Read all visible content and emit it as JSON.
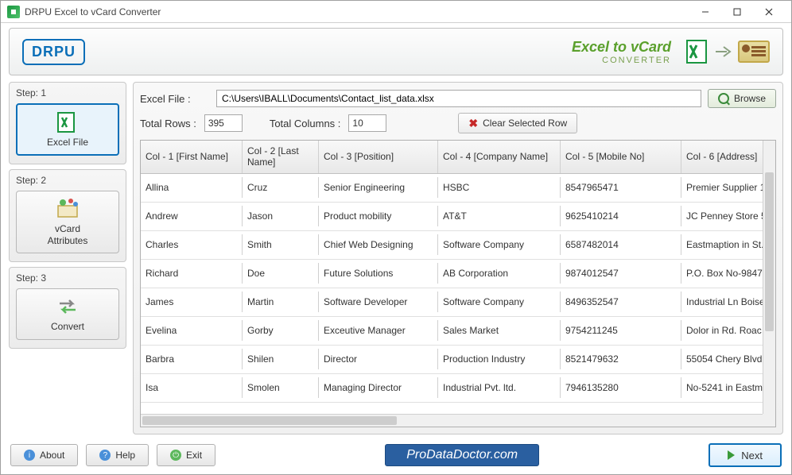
{
  "window": {
    "title": "DRPU Excel to vCard Converter"
  },
  "banner": {
    "logo": "DRPU",
    "title_main": "Excel to vCard",
    "title_sub": "CONVERTER"
  },
  "sidebar": {
    "steps": [
      {
        "label": "Step:  1",
        "btn": "Excel File"
      },
      {
        "label": "Step:  2",
        "btn": "vCard\nAttributes"
      },
      {
        "label": "Step:  3",
        "btn": "Convert"
      }
    ]
  },
  "main": {
    "file_label": "Excel File :",
    "file_path": "C:\\Users\\IBALL\\Documents\\Contact_list_data.xlsx",
    "browse": "Browse",
    "rows_label": "Total Rows :",
    "rows_value": "395",
    "cols_label": "Total Columns :",
    "cols_value": "10",
    "clear": "Clear Selected Row",
    "headers": [
      "Col - 1 [First Name]",
      "Col - 2 [Last Name]",
      "Col - 3 [Position]",
      "Col - 4 [Company Name]",
      "Col - 5 [Mobile No]",
      "Col - 6 [Address]"
    ],
    "rows": [
      [
        "Allina",
        "Cruz",
        "Senior Engineering",
        "HSBC",
        "8547965471",
        "Premier Supplier 1"
      ],
      [
        "Andrew",
        "Jason",
        "Product mobility",
        "AT&T",
        "9625410214",
        "JC Penney Store 5"
      ],
      [
        "Charles",
        "Smith",
        "Chief Web Designing",
        "Software Company",
        "6587482014",
        "Eastmaption in St."
      ],
      [
        "Richard",
        "Doe",
        "Future Solutions",
        "AB Corporation",
        "9874012547",
        "P.O. Box No-9847"
      ],
      [
        "James",
        "Martin",
        "Software Developer",
        "Software Company",
        "8496352547",
        "Industrial Ln Boise"
      ],
      [
        "Evelina",
        "Gorby",
        "Exceutive Manager",
        "Sales Market",
        "9754211245",
        "Dolor in Rd.  Roac"
      ],
      [
        "Barbra",
        "Shilen",
        "Director",
        "Production Industry",
        "8521479632",
        "55054 Chery Blvd"
      ],
      [
        "Isa",
        "Smolen",
        "Managing Director",
        "Industrial Pvt. ltd.",
        "7946135280",
        "No-5241 in Eastm"
      ]
    ]
  },
  "footer": {
    "about": "About",
    "help": "Help",
    "exit": "Exit",
    "brand": "ProDataDoctor.com",
    "next": "Next"
  }
}
